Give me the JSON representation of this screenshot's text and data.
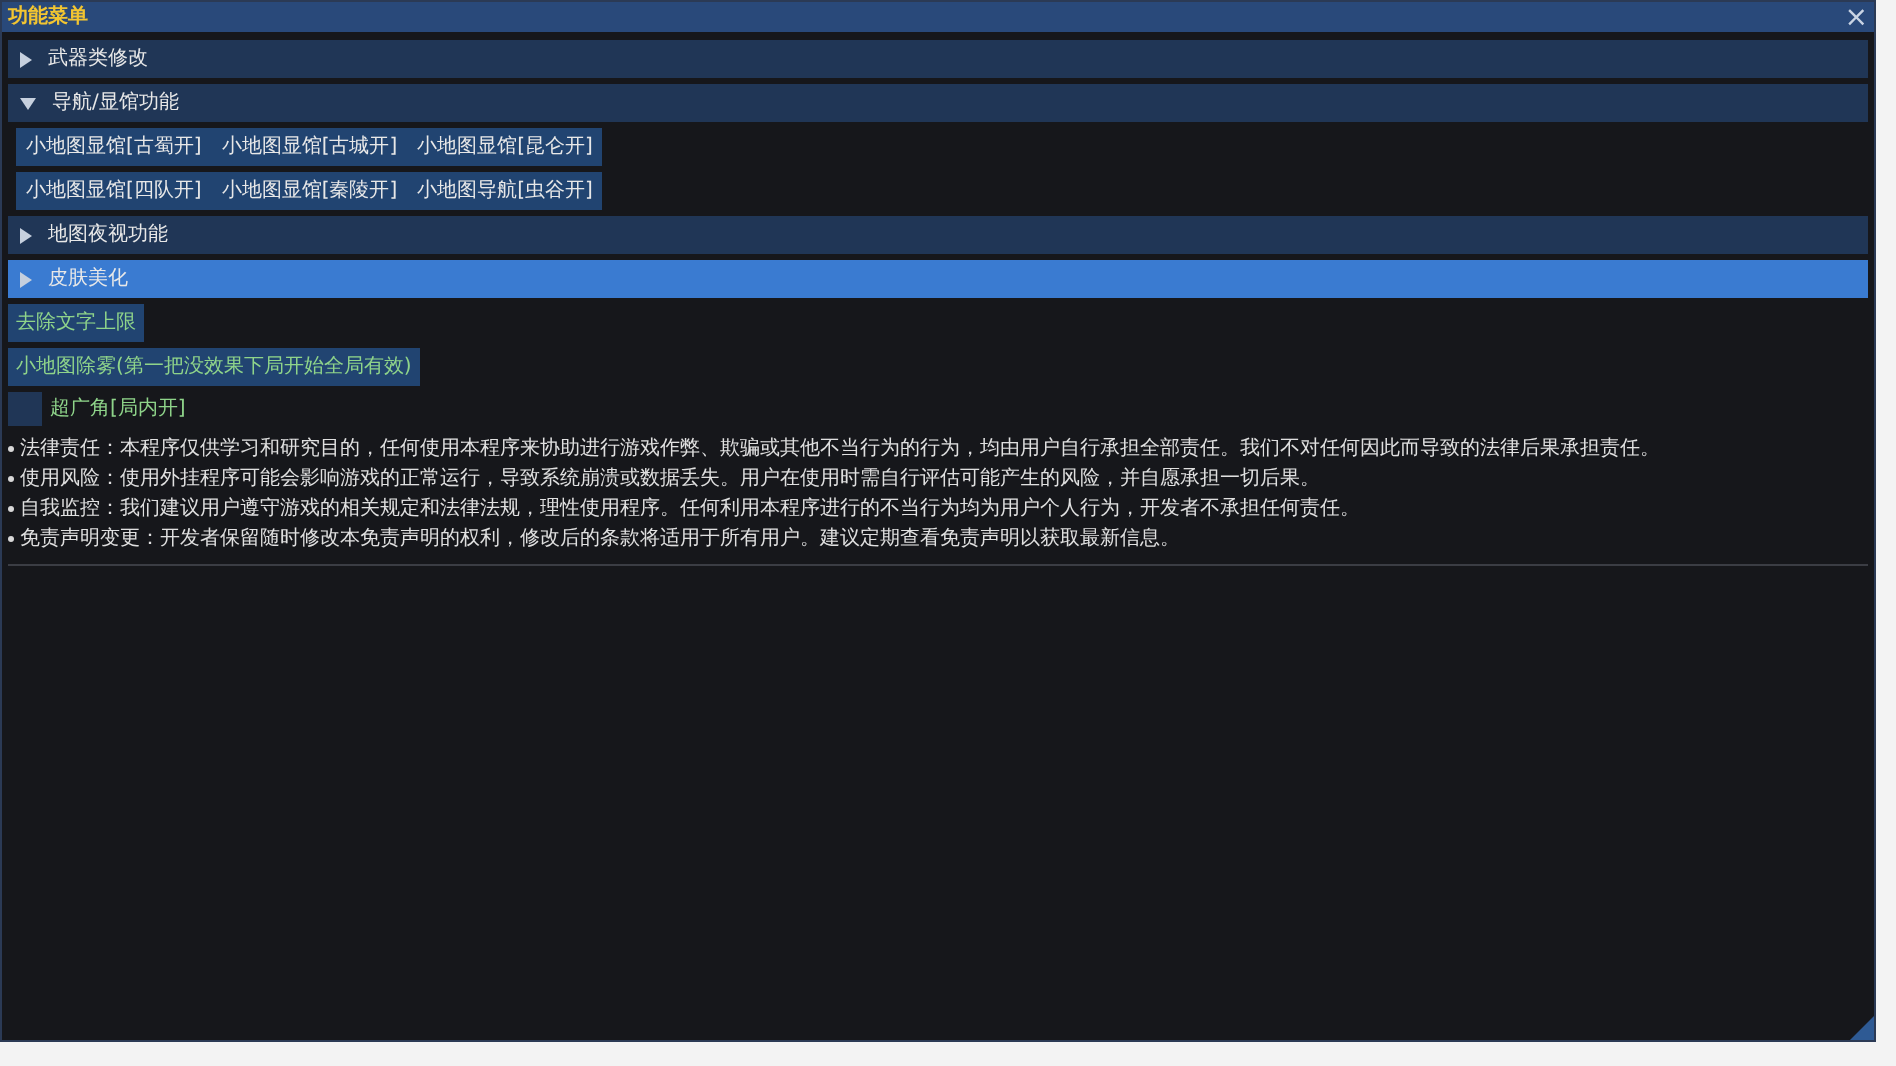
{
  "window": {
    "title": "功能菜单",
    "close": "×"
  },
  "sections": [
    {
      "label": "武器类修改",
      "expanded": false,
      "selected": false
    },
    {
      "label": "导航/显馆功能",
      "expanded": true,
      "selected": false,
      "buttons": [
        [
          "小地图显馆[古蜀开]",
          "小地图显馆[古城开]",
          "小地图显馆[昆仑开]"
        ],
        [
          "小地图显馆[四队开]",
          "小地图显馆[秦陵开]",
          "小地图导航[虫谷开]"
        ]
      ]
    },
    {
      "label": "地图夜视功能",
      "expanded": false,
      "selected": false
    },
    {
      "label": "皮肤美化",
      "expanded": false,
      "selected": true
    }
  ],
  "actions": [
    {
      "kind": "button",
      "label": "去除文字上限"
    },
    {
      "kind": "button",
      "label": "小地图除雾(第一把没效果下局开始全局有效)"
    },
    {
      "kind": "checkbox",
      "label": "超广角[局内开]",
      "checked": false
    }
  ],
  "notes": [
    "法律责任：本程序仅供学习和研究目的，任何使用本程序来协助进行游戏作弊、欺骗或其他不当行为的行为，均由用户自行承担全部责任。我们不对任何因此而导致的法律后果承担责任。",
    "使用风险：使用外挂程序可能会影响游戏的正常运行，导致系统崩溃或数据丢失。用户在使用时需自行评估可能产生的风险，并自愿承担一切后果。",
    "自我监控：我们建议用户遵守游戏的相关规定和法律法规，理性使用程序。任何利用本程序进行的不当行为均为用户个人行为，开发者不承担任何责任。",
    "免责声明变更：开发者保留随时修改本免责声明的权利，修改后的条款将适用于所有用户。建议定期查看免责声明以获取最新信息。"
  ]
}
